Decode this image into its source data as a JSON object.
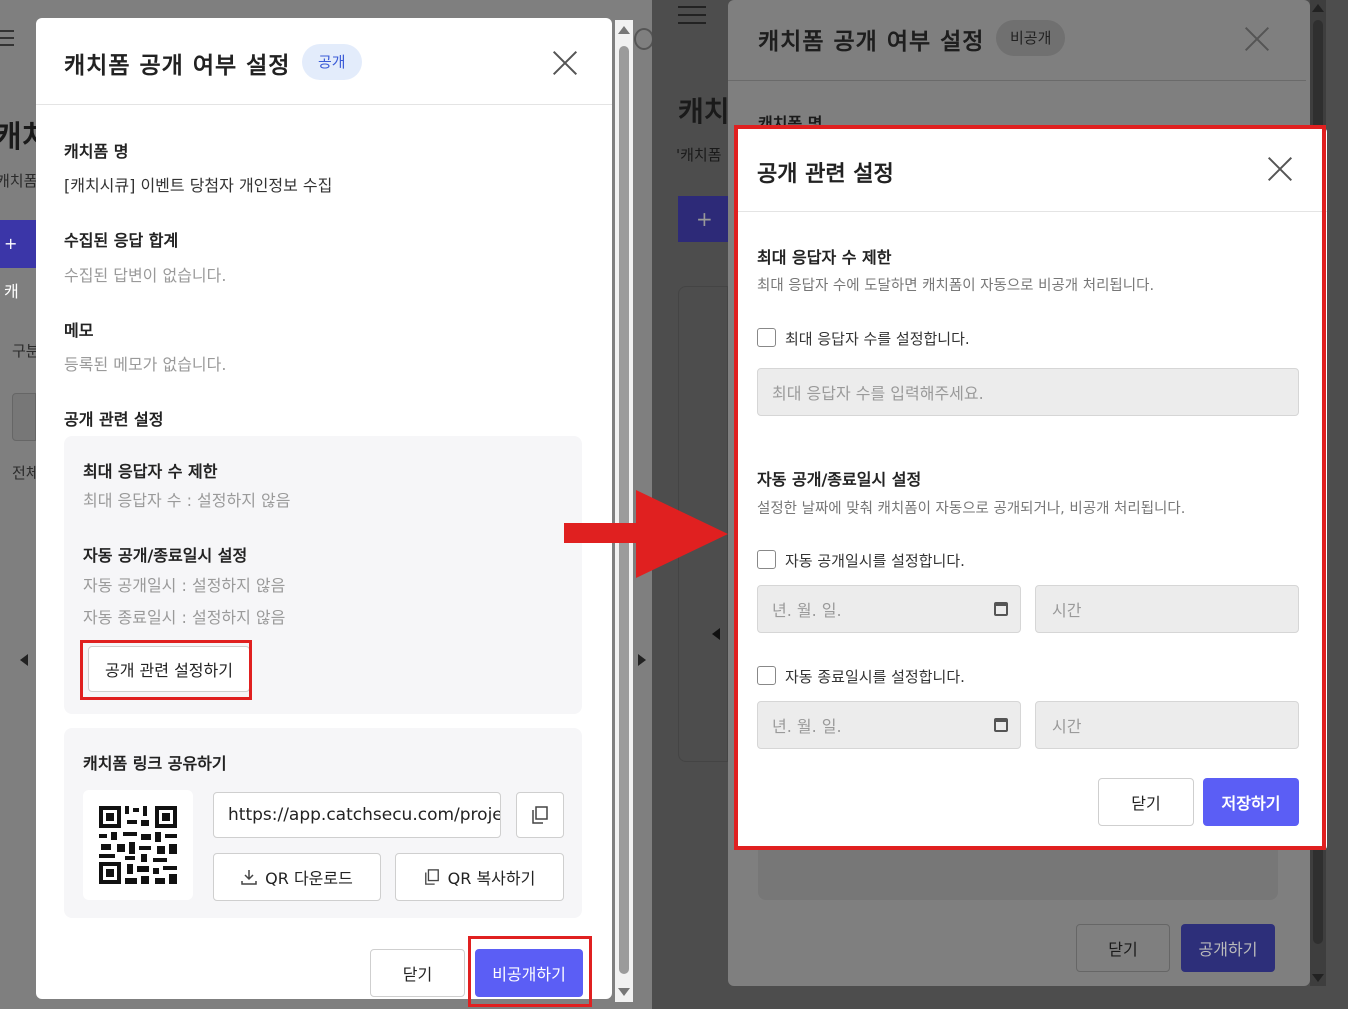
{
  "left_modal": {
    "title": "캐치폼 공개 여부 설정",
    "status_badge": "공개",
    "form_name_label": "캐치폼 명",
    "form_name_value": "[캐치시큐] 이벤트 당첨자 개인정보 수집",
    "responses_label": "수집된 응답 합계",
    "responses_value": "수집된 답변이 없습니다.",
    "memo_label": "메모",
    "memo_value": "등록된 메모가 없습니다.",
    "public_settings_label": "공개 관련 설정",
    "max_resp_title": "최대 응답자 수 제한",
    "max_resp_value": "최대 응답자 수 : 설정하지 않음",
    "auto_title": "자동 공개/종료일시 설정",
    "auto_open_value": "자동 공개일시 : 설정하지 않음",
    "auto_close_value": "자동 종료일시 : 설정하지 않음",
    "settings_button": "공개 관련 설정하기",
    "share_title": "캐치폼 링크 공유하기",
    "share_url": "https://app.catchsecu.com/proje",
    "qr_download": "QR 다운로드",
    "qr_copy": "QR 복사하기",
    "close_button": "닫기",
    "unpublish_button": "비공개하기"
  },
  "background_left": {
    "heading_fragment": "캐치",
    "text_fragment": "캐치폼",
    "button_fragment": "+ 캐",
    "label_fragment": "구분",
    "label_fragment_2": "전체"
  },
  "right_back_modal": {
    "title": "캐치폼 공개 여부 설정",
    "status_badge": "비공개",
    "form_name_label": "캐치폼 명",
    "form_name_fragment": "'캐치폼",
    "heading_fragment": "캐치",
    "close_button": "닫기",
    "publish_button": "공개하기"
  },
  "dialog": {
    "title": "공개 관련 설정",
    "max_title": "최대 응답자 수 제한",
    "max_desc": "최대 응답자 수에 도달하면 캐치폼이 자동으로 비공개 처리됩니다.",
    "max_checkbox_label": "최대 응답자 수를 설정합니다.",
    "max_input_placeholder": "최대 응답자 수를 입력해주세요.",
    "auto_title": "자동 공개/종료일시 설정",
    "auto_desc": "설정한 날짜에 맞춰 캐치폼이 자동으로 공개되거나, 비공개 처리됩니다.",
    "open_checkbox_label": "자동 공개일시를 설정합니다.",
    "close_checkbox_label": "자동 종료일시를 설정합니다.",
    "date_placeholder": "년. 월. 일.",
    "time_placeholder": "시간",
    "close_button": "닫기",
    "save_button": "저장하기"
  },
  "colors": {
    "primary": "#5b5ef5",
    "highlight": "#e02020",
    "badge_bg": "#e3ecfb",
    "badge_text": "#3b5bd7"
  }
}
